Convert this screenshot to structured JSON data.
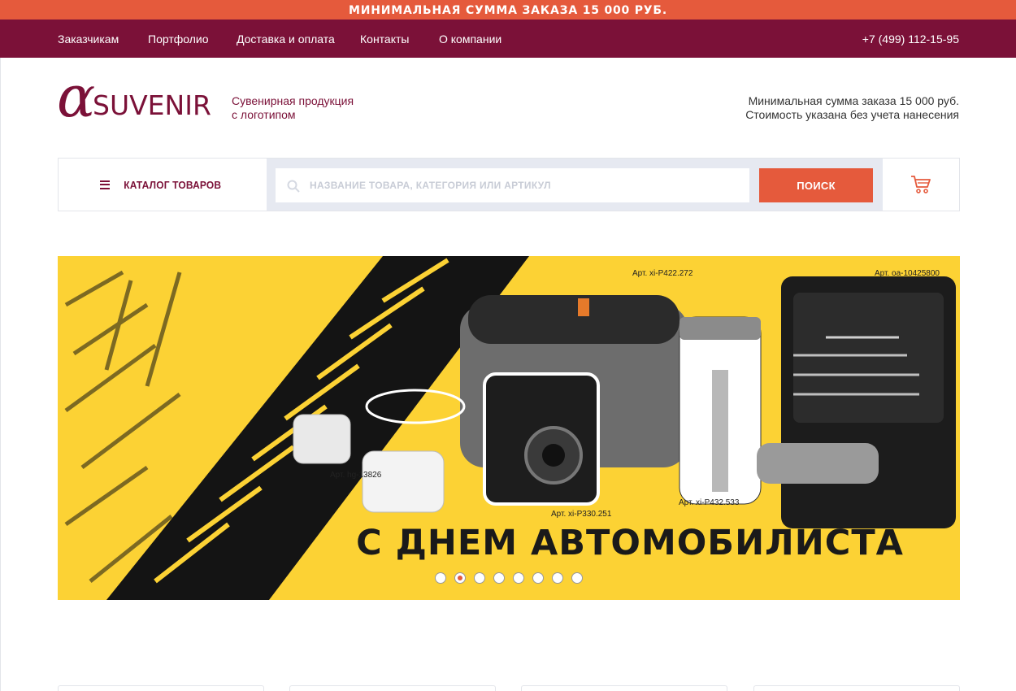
{
  "promo": {
    "text": "МИНИМАЛЬНАЯ СУММА ЗАКАЗА 15 000 РУБ."
  },
  "topnav": {
    "items": [
      {
        "label": "Заказчикам"
      },
      {
        "label": "Портфолио"
      },
      {
        "label": "Доставка и оплата"
      },
      {
        "label": "Контакты"
      },
      {
        "label": "О компании"
      }
    ],
    "phone": "+7 (499) 112-15-95"
  },
  "header": {
    "logo_alpha": "α",
    "logo_word": "SUVENIR",
    "tagline_line1": "Сувенирная продукция",
    "tagline_line2": "с логотипом",
    "info_line1": "Минимальная сумма заказа 15 000 руб.",
    "info_line2": "Стоимость указана без учета нанесения"
  },
  "search": {
    "catalog_label": "КАТАЛОГ ТОВАРОВ",
    "placeholder": "НАЗВАНИЕ ТОВАРА, КАТЕГОРИЯ ИЛИ АРТИКУЛ",
    "value": "",
    "button_label": "ПОИСК",
    "cart_icon": "cart-icon"
  },
  "banner": {
    "headline": "С ДНЕМ АВТОМОБИЛИСТА",
    "labels": [
      "Арт. xi-P422.272",
      "Арт. oa-10425800",
      "Арт. hg-13826",
      "Арт. xi-P330.251",
      "Арт. xi-P432.533"
    ],
    "slide_count": 8,
    "active_slide": 2
  },
  "colors": {
    "accent": "#e55a3c",
    "brand": "#7b1138",
    "banner_bg": "#fcd234",
    "search_zone": "#e6e9f1"
  }
}
